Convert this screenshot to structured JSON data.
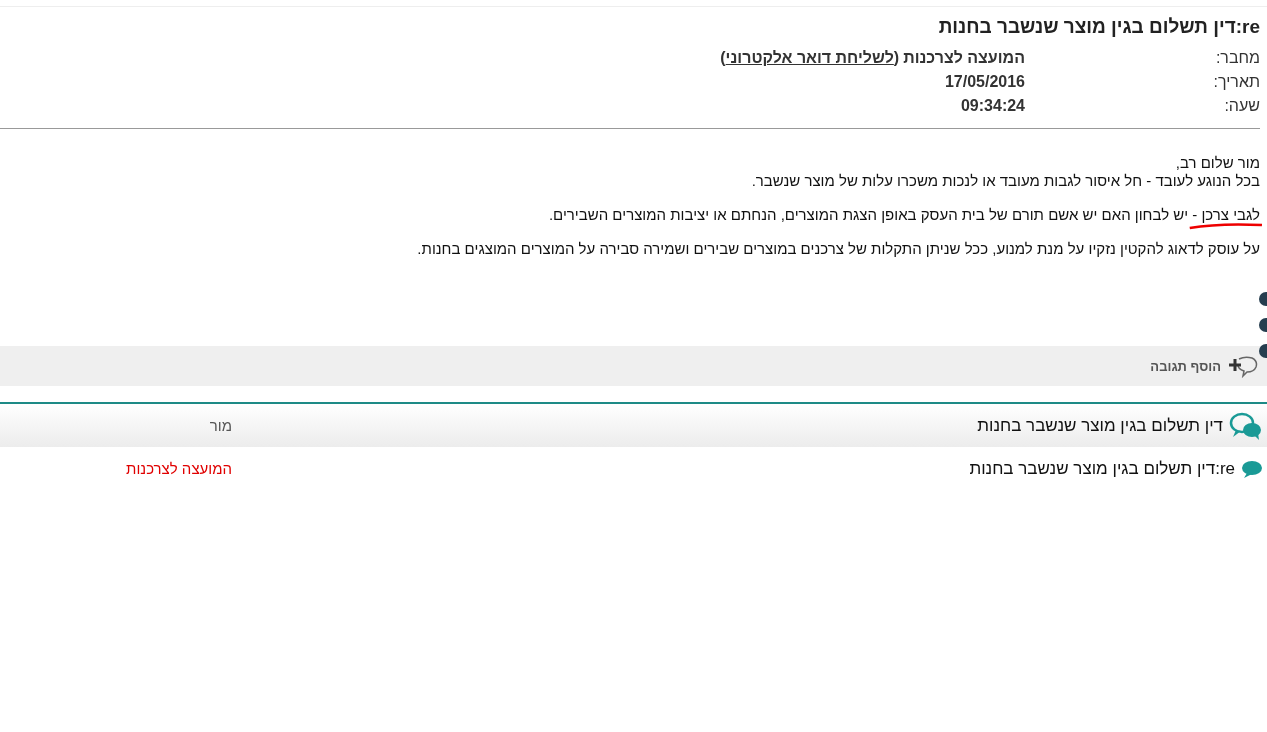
{
  "message": {
    "title": "re:דין תשלום בגין מוצר שנשבר בחנות",
    "meta": [
      {
        "label": "מחבר:",
        "value": "המועצה לצרכנות",
        "link": "(לשליחת דואר אלקטרוני)"
      },
      {
        "label": "תאריך:",
        "value": "17/05/2016"
      },
      {
        "label": "שעה:",
        "value": "09:34:24"
      }
    ],
    "body": [
      {
        "lines": [
          "מור שלום רב,",
          "בכל הנוגע לעובד - חל איסור לגבות מעובד או לנכות משכרו עלות של מוצר שנשבר."
        ]
      },
      {
        "underlined_lead": "לגבי צרכן -",
        "lines": [
          "יש לבחון האם יש אשם תורם של בית העסק באופן הצגת המוצרים, הנחתם או יציבות המוצרים השבירים."
        ]
      },
      {
        "lines": [
          "על עוסק לדאוג להקטין נזקיו על מנת למנוע, ככל שניתן התקלות של צרכנים במוצרים שבירים ושמירה סבירה על המוצרים המוצגים בחנות."
        ]
      }
    ]
  },
  "add_reply": {
    "label": "הוסף תגובה"
  },
  "thread": [
    {
      "kind": "root",
      "title": "דין תשלום בגין מוצר שנשבר בחנות",
      "author": "מור",
      "highlighted": false
    },
    {
      "kind": "reply",
      "title": "re:דין תשלום בגין מוצר שנשבר בחנות",
      "author": "המועצה לצרכנות",
      "highlighted": true
    }
  ]
}
